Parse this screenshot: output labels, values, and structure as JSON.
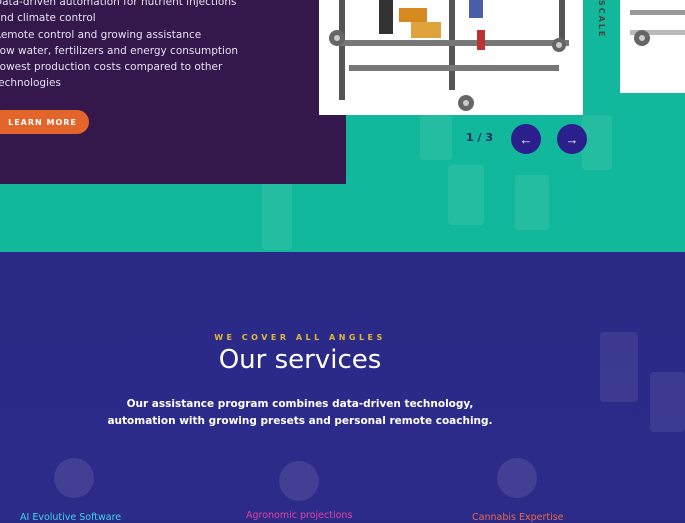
{
  "hero": {
    "features": [
      "Data-driven automation for nutrient injections",
      "and climate control",
      "Remote control and growing assistance",
      "Low water, fertilizers and energy consumption",
      "Lowest production costs compared to other",
      "technologies"
    ],
    "learn_more_label": "LEARN MORE",
    "side_label": "SCALE",
    "counter": "1 / 3",
    "prev_glyph": "←",
    "next_glyph": "→",
    "btn_color": "#e4652a",
    "teal_color": "#12b89b"
  },
  "services": {
    "eyebrow": "WE COVER ALL ANGLES",
    "title": "Our services",
    "description_line1": "Our assistance program combines data-driven technology,",
    "description_line2": "automation with growing presets and personal remote coaching.",
    "items": [
      {
        "label": "AI Evolutive Software",
        "color": "#3fd3e6"
      },
      {
        "label": "Agronomic projections",
        "color": "#e0439b"
      },
      {
        "label": "Cannabis Expertise",
        "color": "#e56a4a"
      }
    ]
  }
}
